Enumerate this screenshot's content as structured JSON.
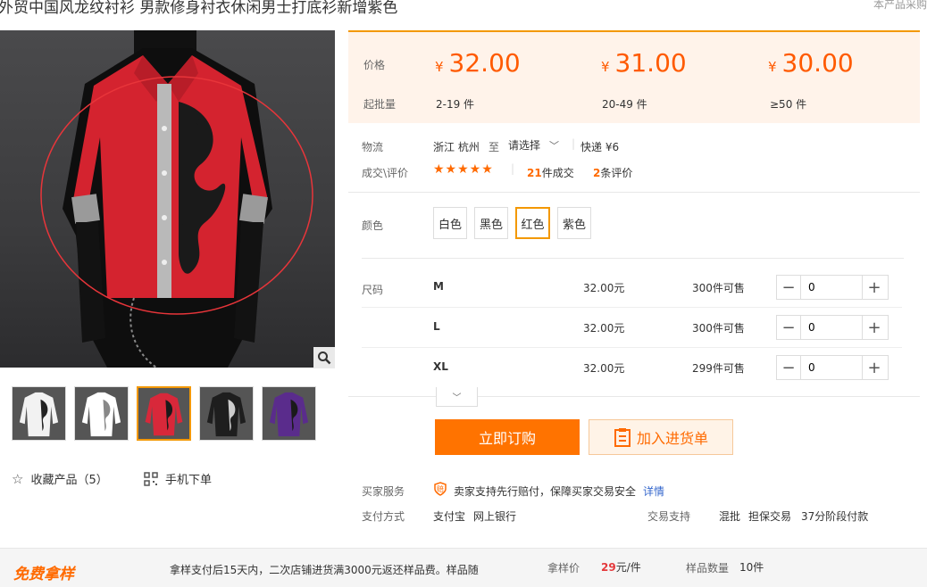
{
  "product": {
    "title": "外贸中国风龙纹衬衫 男款修身衬衣休闲男士打底衫新增紫色",
    "note": "本产品采购"
  },
  "gallery": {
    "thumbnails": [
      {
        "name": "white-shirt-black-dragon",
        "shirt_color": "#f2f2f2",
        "print_color": "#222222",
        "active": false
      },
      {
        "name": "white-shirt-white",
        "shirt_color": "#ffffff",
        "print_color": "#888888",
        "active": false
      },
      {
        "name": "red-shirt",
        "shirt_color": "#d8283a",
        "print_color": "#1a1a1a",
        "active": true
      },
      {
        "name": "black-shirt",
        "shirt_color": "#1e1e1e",
        "print_color": "#cccccc",
        "active": false
      },
      {
        "name": "purple-shirt",
        "shirt_color": "#5a2c8c",
        "print_color": "#1a1a1a",
        "active": false
      }
    ],
    "favorite_label": "收藏产品（5）",
    "mobile_label": "手机下单"
  },
  "pricing": {
    "price_label": "价格",
    "batch_label": "起批量",
    "currency": "¥",
    "tiers": [
      {
        "price": "32.00",
        "qty": "2-19 件"
      },
      {
        "price": "31.00",
        "qty": "20-49 件"
      },
      {
        "price": "30.00",
        "qty": "≥50 件"
      }
    ]
  },
  "logistics": {
    "label": "物流",
    "from": "浙江 杭州",
    "to_word": "至",
    "select": "请选择",
    "shipping": "快递 ¥6"
  },
  "reviews": {
    "label": "成交\\评价",
    "stars": 5,
    "deals_count": "21",
    "deals_label": "件成交",
    "review_count": "2",
    "review_label": "条评价"
  },
  "color": {
    "label": "颜色",
    "options": [
      "白色",
      "黑色",
      "红色",
      "紫色"
    ],
    "selected_index": 2
  },
  "sizes": {
    "label": "尺码",
    "rows": [
      {
        "name": "M",
        "price": "32.00元",
        "stock": "300件可售",
        "qty": "0"
      },
      {
        "name": "L",
        "price": "32.00元",
        "stock": "300件可售",
        "qty": "0"
      },
      {
        "name": "XL",
        "price": "32.00元",
        "stock": "299件可售",
        "qty": "0"
      }
    ]
  },
  "actions": {
    "buy": "立即订购",
    "cart": "加入进货单"
  },
  "services": {
    "label": "买家服务",
    "text": "卖家支持先行赔付，保障买家交易安全",
    "detail": "详情"
  },
  "payment": {
    "label": "支付方式",
    "methods": [
      "支付宝",
      "网上银行"
    ],
    "trade_label": "交易支持",
    "trade_items": [
      "混批",
      "担保交易",
      "37分阶段付款"
    ]
  },
  "sample": {
    "badge": "免费拿样",
    "desc": "拿样支付后15天内，二次店铺进货满3000元返还样品费。样品随",
    "price_label": "拿样价",
    "price_value": "29",
    "price_unit": "元/件",
    "qty_label": "样品数量",
    "qty_value": "10件"
  },
  "colors": {
    "accent": "#ff7300",
    "price": "#ff5a00",
    "link": "#3366cc"
  }
}
